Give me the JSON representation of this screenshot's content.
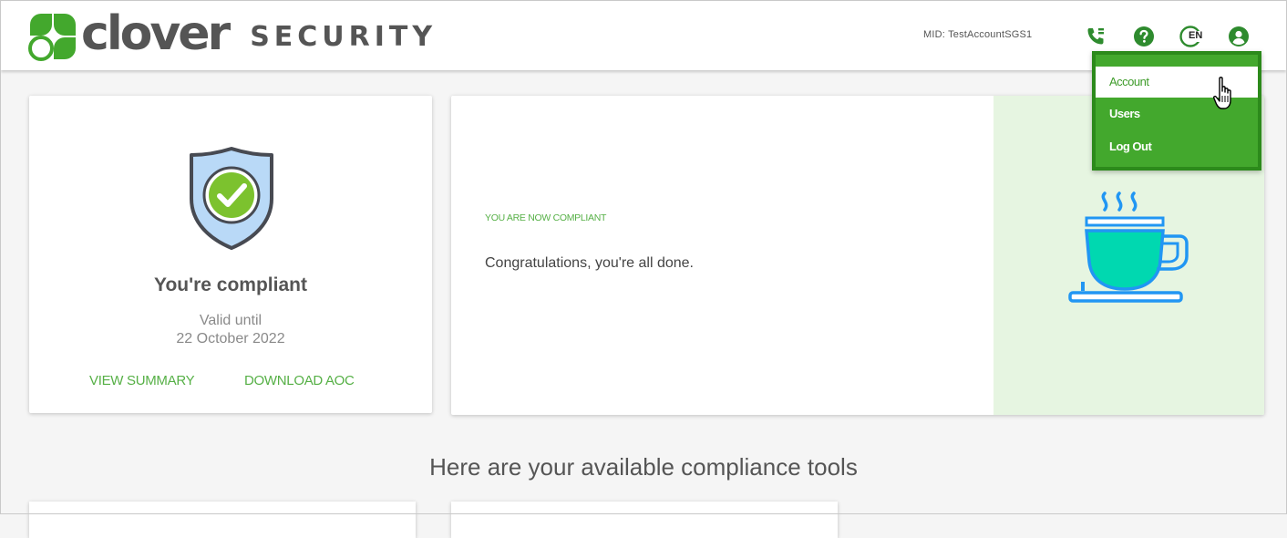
{
  "header": {
    "logo_text": "clover",
    "logo_subtitle": "SECURITY",
    "mid_label": "MID: TestAccountSGS1",
    "icons": [
      "phone-icon",
      "help-icon",
      "language-icon",
      "account-icon"
    ],
    "language_code": "EN"
  },
  "account_menu": {
    "items": [
      {
        "label": "Account",
        "active": true
      },
      {
        "label": "Users",
        "active": false
      },
      {
        "label": "Log Out",
        "active": false
      }
    ]
  },
  "compliance_card": {
    "title": "You're compliant",
    "valid_until_label": "Valid until",
    "valid_date": "22 October 2022",
    "links": {
      "summary": "VIEW SUMMARY",
      "download": "DOWNLOAD AOC"
    }
  },
  "status_card": {
    "status_label": "YOU ARE NOW COMPLIANT",
    "message": "Congratulations, you're all done.",
    "illustration": "coffee-cup-icon"
  },
  "tools": {
    "heading": "Here are your available compliance tools"
  },
  "colors": {
    "brand_green": "#43a82d",
    "link_green": "#56b046",
    "panel_green": "#e6f5e1",
    "cup_blue": "#2196f3",
    "cup_teal": "#00d8b0"
  }
}
